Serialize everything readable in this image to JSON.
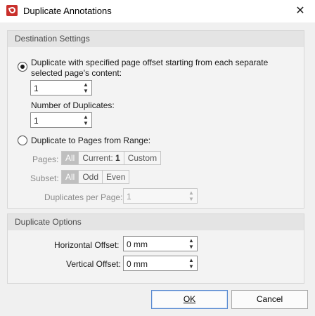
{
  "window": {
    "title": "Duplicate Annotations",
    "close_glyph": "✕"
  },
  "destination": {
    "header": "Destination Settings",
    "option_offset": {
      "line1": "Duplicate with specified page offset starting from each separate",
      "line2": "selected page's content:",
      "offset_value": "1",
      "num_duplicates_label": "Number of Duplicates:",
      "num_duplicates_value": "1"
    },
    "option_range": {
      "label": "Duplicate to Pages from Range:",
      "pages_label": "Pages:",
      "pages_options": {
        "all": "All",
        "current": "Current: ",
        "current_num": "1",
        "custom": "Custom"
      },
      "subset_label": "Subset:",
      "subset_options": {
        "all": "All",
        "odd": "Odd",
        "even": "Even"
      },
      "dup_per_page_label": "Duplicates per Page:",
      "dup_per_page_value": "1"
    }
  },
  "duplicate_options": {
    "header": "Duplicate Options",
    "horizontal_label": "Horizontal Offset:",
    "horizontal_value": "0 mm",
    "vertical_label": "Vertical Offset:",
    "vertical_value": "0 mm"
  },
  "buttons": {
    "ok": "OK",
    "cancel": "Cancel"
  },
  "icons": {
    "app": "pdf-editor-app-icon",
    "spin_up": "▲",
    "spin_down": "▼"
  }
}
